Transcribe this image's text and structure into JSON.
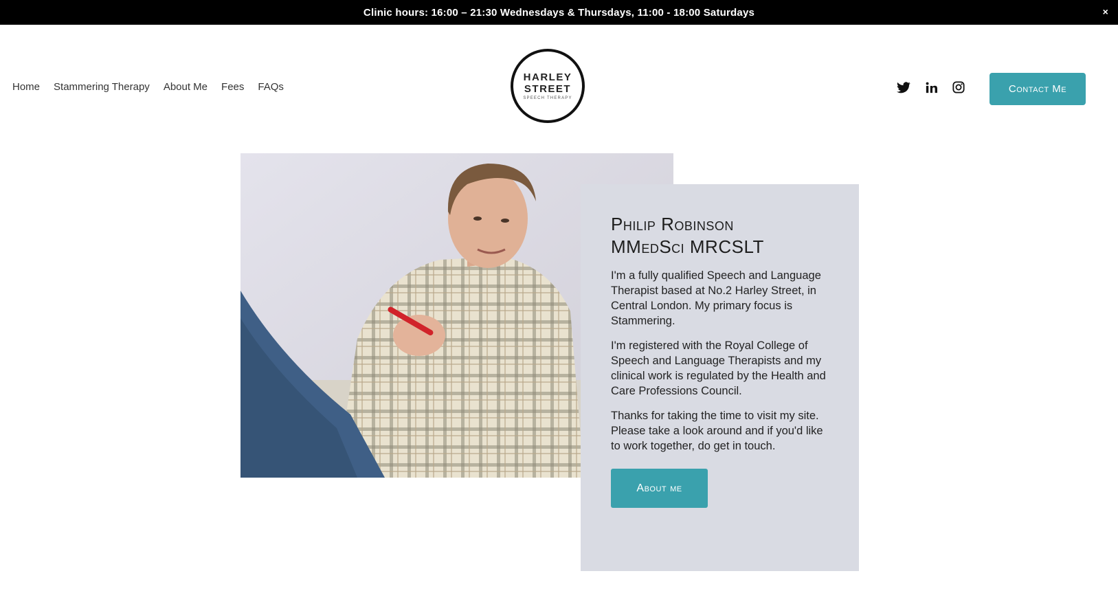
{
  "announcement": {
    "text": "Clinic hours: 16:00 – 21:30 Wednesdays & Thursdays, 11:00 - 18:00 Saturdays",
    "close_label": "×"
  },
  "nav": {
    "items": [
      {
        "label": "Home"
      },
      {
        "label": "Stammering Therapy"
      },
      {
        "label": "About Me"
      },
      {
        "label": "Fees"
      },
      {
        "label": "FAQs"
      }
    ]
  },
  "logo": {
    "line1": "HARLEY",
    "line2": "STREET",
    "line3": "SPEECH THERAPY"
  },
  "social": {
    "icons": [
      "twitter-icon",
      "linkedin-icon",
      "instagram-icon"
    ]
  },
  "header": {
    "contact_label": "Contact Me"
  },
  "profile": {
    "name": "Philip Robinson",
    "credentials": "MMedSci MRCSLT",
    "paragraphs": [
      "I'm a fully qualified Speech and Language Therapist based at No.2 Harley Street, in Central London. My primary focus is Stammering.",
      "I'm registered with the Royal College of Speech and Language Therapists and my clinical work is regulated by the Health and Care Professions Council.",
      "Thanks for taking the time to visit my site.  Please take a look around and if you'd like to work together, do get in touch."
    ],
    "button_label": "About me"
  },
  "colors": {
    "accent": "#3aa1ad",
    "card_bg": "#d9dbe3",
    "announcement_bg": "#000000"
  }
}
